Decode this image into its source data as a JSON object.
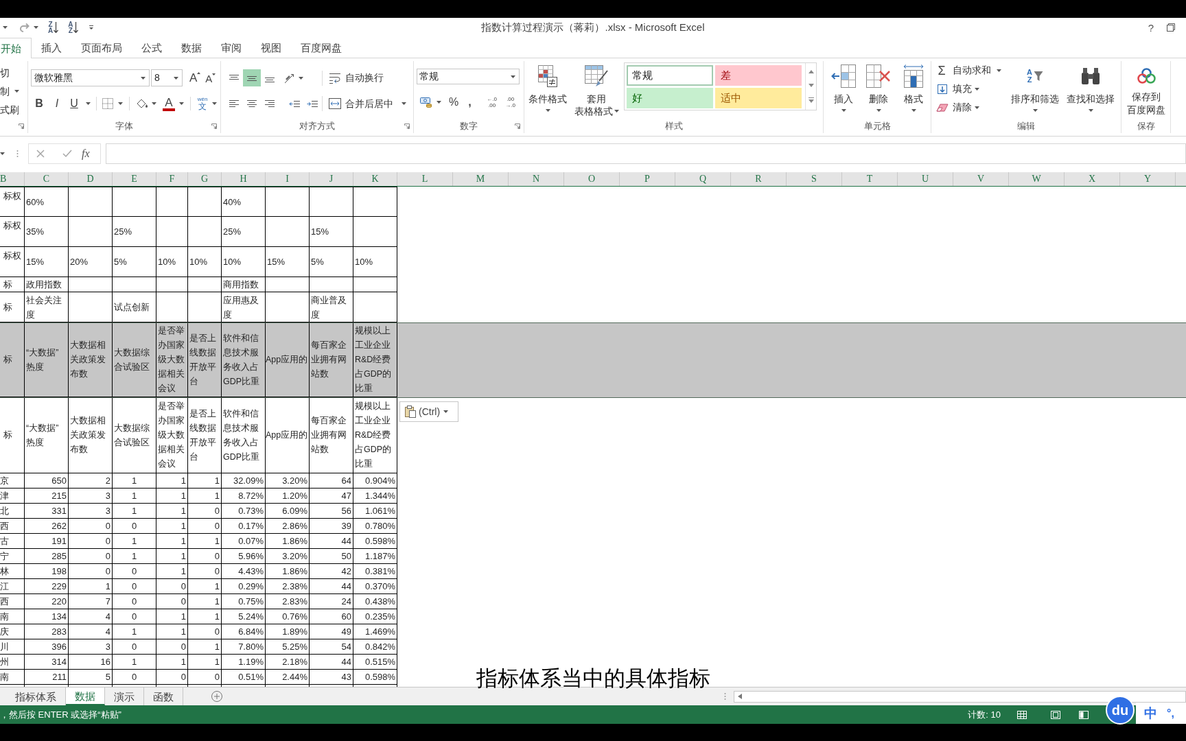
{
  "window": {
    "title": "指数计算过程演示（蒋莉）.xlsx - Microsoft Excel",
    "help": "?"
  },
  "quick_access": {
    "sort_buttons": [
      {
        "top": "Z",
        "bottom": "A"
      },
      {
        "top": "A",
        "bottom": "Z"
      }
    ]
  },
  "ribbon_tabs": [
    {
      "label": "开始",
      "selected": true
    },
    {
      "label": "插入",
      "selected": false
    },
    {
      "label": "页面布局",
      "selected": false
    },
    {
      "label": "公式",
      "selected": false
    },
    {
      "label": "数据",
      "selected": false
    },
    {
      "label": "审阅",
      "selected": false
    },
    {
      "label": "视图",
      "selected": false
    },
    {
      "label": "百度网盘",
      "selected": false
    }
  ],
  "clipboard": {
    "items": [
      {
        "label": "切",
        "dropdown": false
      },
      {
        "label": "制",
        "dropdown": true
      },
      {
        "label": "式刷",
        "dropdown": false
      }
    ]
  },
  "font": {
    "name": "微软雅黑",
    "size": "8",
    "grow": "A",
    "shrink": "A",
    "styles": [
      "B",
      "I",
      "U"
    ],
    "color_letter": "A",
    "phonetic": {
      "top": "wén",
      "bottom": "文"
    },
    "label": "字体"
  },
  "alignment": {
    "vertical": [
      {
        "kind": "top",
        "selected": false
      },
      {
        "kind": "middle",
        "selected": true
      },
      {
        "kind": "bottom",
        "selected": false
      }
    ],
    "horizontal": [
      {
        "kind": "left",
        "selected": false
      },
      {
        "kind": "center",
        "selected": false
      },
      {
        "kind": "right",
        "selected": false
      }
    ],
    "wrap_text": "自动换行",
    "merge_center": "合并后居中",
    "label": "对齐方式"
  },
  "number": {
    "format": "常规",
    "percent": "%",
    "comma": ",",
    "decimals": [
      {
        "top": "←.0",
        "bottom": ".00"
      },
      {
        "top": ".00",
        "bottom": "→.0"
      }
    ],
    "label": "数字"
  },
  "styles": {
    "conditional_format": "条件格式",
    "table_format": [
      "套用",
      "表格格式"
    ],
    "gallery": [
      {
        "label": "常规",
        "kind": "normal",
        "selected": true
      },
      {
        "label": "差",
        "kind": "bad",
        "selected": false
      },
      {
        "label": "好",
        "kind": "good",
        "selected": false
      },
      {
        "label": "适中",
        "kind": "neutral",
        "selected": false
      }
    ],
    "label": "样式"
  },
  "cells": {
    "buttons": [
      {
        "label": "插入",
        "kind": "insert"
      },
      {
        "label": "删除",
        "kind": "delete"
      },
      {
        "label": "格式",
        "kind": "format"
      }
    ],
    "label": "单元格"
  },
  "editing": {
    "autosum_symbol": "Σ",
    "autosum": "自动求和",
    "fill": "填充",
    "clear": "清除",
    "sort_filter": {
      "label": "排序和筛选",
      "top": "A",
      "bottom": "Z"
    },
    "find_select": "查找和选择",
    "label": "编辑"
  },
  "save": {
    "lines": [
      "保存到",
      "百度网盘"
    ],
    "label": "保存"
  },
  "formula_bar": {
    "function_button": "fx"
  },
  "sheet": {
    "columns": [
      "B",
      "C",
      "D",
      "E",
      "F",
      "G",
      "H",
      "I",
      "J",
      "K",
      "L",
      "M",
      "N",
      "O",
      "P",
      "Q",
      "R",
      "S",
      "T",
      "U",
      "V",
      "W",
      "X",
      "Y"
    ],
    "rows": [
      {
        "kind": "weight",
        "selected": false,
        "cells": [
          {
            "text": "标权"
          },
          {
            "text": "60%"
          },
          null,
          null,
          null,
          null,
          {
            "text": "40%"
          },
          null,
          null,
          null
        ]
      },
      {
        "kind": "weight",
        "selected": false,
        "cells": [
          {
            "text": "标权"
          },
          {
            "text": "35%"
          },
          null,
          {
            "text": "25%"
          },
          null,
          null,
          {
            "text": "25%"
          },
          null,
          {
            "text": "15%"
          },
          null
        ]
      },
      {
        "kind": "weight",
        "selected": false,
        "cells": [
          {
            "text": "标权"
          },
          {
            "text": "15%"
          },
          {
            "text": "20%"
          },
          {
            "text": "5%"
          },
          {
            "text": "10%"
          },
          {
            "text": "10%"
          },
          {
            "text": "10%"
          },
          {
            "text": "15%"
          },
          {
            "text": "5%"
          },
          {
            "text": "10%"
          }
        ]
      },
      {
        "kind": "group",
        "selected": false,
        "cells": [
          {
            "text": "标"
          },
          {
            "text": "政用指数"
          },
          null,
          null,
          null,
          null,
          {
            "text": "商用指数"
          },
          null,
          null,
          null
        ]
      },
      {
        "kind": "subgroup",
        "selected": false,
        "cells": [
          {
            "text": "标"
          },
          {
            "text": "社会关注度"
          },
          null,
          {
            "text": "试点创新"
          },
          null,
          null,
          {
            "text": "应用惠及度"
          },
          null,
          {
            "text": "商业普及度"
          },
          null
        ]
      },
      {
        "kind": "indicator",
        "selected": true,
        "cells": [
          {
            "text": "标"
          },
          {
            "text": "“大数据”热度"
          },
          {
            "text": "大数据相关政策发布数"
          },
          {
            "text": "大数据综合试验区"
          },
          {
            "text": "是否举办国家级大数据相关会议"
          },
          {
            "text": "是否上线数据开放平台"
          },
          {
            "text": "软件和信息技术服务收入占GDP比重"
          },
          {
            "text": "App应用的",
            "wrap": false
          },
          {
            "text": "每百家企业拥有网站数"
          },
          {
            "text": "规模以上工业企业R&D经费占GDP的比重"
          }
        ]
      },
      {
        "kind": "indicator",
        "selected": false,
        "cells": [
          {
            "text": "标"
          },
          {
            "text": "“大数据”热度"
          },
          {
            "text": "大数据相关政策发布数"
          },
          {
            "text": "大数据综合试验区"
          },
          {
            "text": "是否举办国家级大数据相关会议"
          },
          {
            "text": "是否上线数据开放平台"
          },
          {
            "text": "软件和信息技术服务收入占GDP比重"
          },
          {
            "text": "App应用的",
            "wrap": false
          },
          {
            "text": "每百家企业拥有网站数"
          },
          {
            "text": "规模以上工业企业R&D经费占GDP的比重"
          }
        ]
      },
      {
        "kind": "data",
        "selected": false,
        "label": "京",
        "values": [
          "650",
          "2",
          "1",
          "1",
          "1",
          "32.09%",
          "3.20%",
          "64",
          "0.904%"
        ]
      },
      {
        "kind": "data",
        "selected": false,
        "label": "津",
        "values": [
          "215",
          "3",
          "1",
          "1",
          "1",
          "8.72%",
          "1.20%",
          "47",
          "1.344%"
        ]
      },
      {
        "kind": "data",
        "selected": false,
        "label": "北",
        "values": [
          "331",
          "3",
          "1",
          "1",
          "0",
          "0.73%",
          "6.09%",
          "56",
          "1.061%"
        ]
      },
      {
        "kind": "data",
        "selected": false,
        "label": "西",
        "values": [
          "262",
          "0",
          "0",
          "1",
          "0",
          "0.17%",
          "2.86%",
          "39",
          "0.780%"
        ]
      },
      {
        "kind": "data",
        "selected": false,
        "label": "古",
        "values": [
          "191",
          "0",
          "1",
          "1",
          "1",
          "0.07%",
          "1.86%",
          "44",
          "0.598%"
        ]
      },
      {
        "kind": "data",
        "selected": false,
        "label": "宁",
        "values": [
          "285",
          "0",
          "1",
          "1",
          "0",
          "5.96%",
          "3.20%",
          "50",
          "1.187%"
        ]
      },
      {
        "kind": "data",
        "selected": false,
        "label": "林",
        "values": [
          "198",
          "0",
          "0",
          "1",
          "0",
          "4.43%",
          "1.86%",
          "42",
          "0.381%"
        ]
      },
      {
        "kind": "data",
        "selected": false,
        "label": "江",
        "values": [
          "229",
          "1",
          "0",
          "0",
          "1",
          "0.29%",
          "2.38%",
          "44",
          "0.370%"
        ]
      },
      {
        "kind": "data",
        "selected": false,
        "label": "西",
        "values": [
          "220",
          "7",
          "0",
          "0",
          "1",
          "0.75%",
          "2.83%",
          "24",
          "0.438%"
        ]
      },
      {
        "kind": "data",
        "selected": false,
        "label": "南",
        "values": [
          "134",
          "4",
          "0",
          "1",
          "1",
          "5.24%",
          "0.76%",
          "60",
          "0.235%"
        ]
      },
      {
        "kind": "data",
        "selected": false,
        "label": "庆",
        "values": [
          "283",
          "4",
          "1",
          "1",
          "0",
          "6.84%",
          "1.89%",
          "49",
          "1.469%"
        ]
      },
      {
        "kind": "data",
        "selected": false,
        "label": "川",
        "values": [
          "396",
          "3",
          "0",
          "0",
          "1",
          "7.80%",
          "5.25%",
          "54",
          "0.842%"
        ]
      },
      {
        "kind": "data",
        "selected": false,
        "label": "州",
        "values": [
          "314",
          "16",
          "1",
          "1",
          "1",
          "1.19%",
          "2.18%",
          "44",
          "0.515%"
        ]
      },
      {
        "kind": "data",
        "selected": false,
        "label": "南",
        "values": [
          "211",
          "5",
          "0",
          "0",
          "0",
          "0.51%",
          "2.44%",
          "43",
          "0.598%"
        ]
      }
    ]
  },
  "paste_options": {
    "label": "(Ctrl)"
  },
  "sheet_tabs": [
    {
      "label": "指标体系",
      "selected": false
    },
    {
      "label": "数据",
      "selected": true
    },
    {
      "label": "演示",
      "selected": false
    },
    {
      "label": "函数",
      "selected": false
    }
  ],
  "status_bar": {
    "message": "，然后按 ENTER 或选择“粘贴”",
    "count": "计数: 10"
  },
  "subtitle": "指标体系当中的具体指标",
  "ime": {
    "logo": "du",
    "mode": "中",
    "punctuation": "°,"
  }
}
